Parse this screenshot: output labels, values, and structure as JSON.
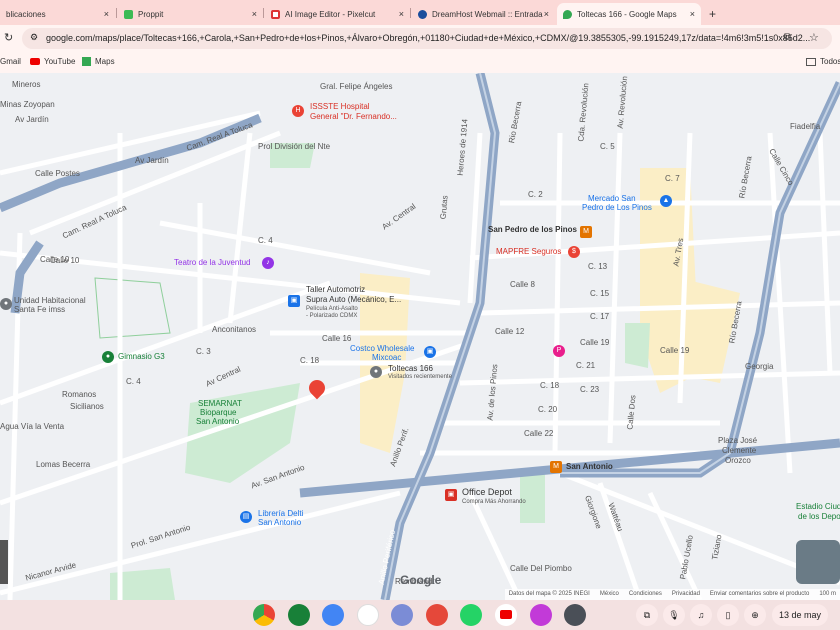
{
  "tabs": [
    {
      "title": "blicaciones"
    },
    {
      "title": "Proppit"
    },
    {
      "title": "AI Image Editor - Pixelcut"
    },
    {
      "title": "DreamHost Webmail :: Entrada"
    },
    {
      "title": "Toltecas 166 - Google Maps",
      "active": true
    }
  ],
  "tab_close": "×",
  "new_tab": "+",
  "url": "google.com/maps/place/Toltecas+166,+Carola,+San+Pedro+de+los+Pinos,+Álvaro+Obregón,+01180+Ciudad+de+México,+CDMX/@19.3855305,-99.1915249,17z/data=!4m6!3m5!1s0x85d2...",
  "bookmarks": [
    {
      "label": "Gmail"
    },
    {
      "label": "YouTube"
    },
    {
      "label": "Maps"
    }
  ],
  "all_bookmarks": "Todos",
  "map": {
    "labels": [
      "Gral. Felipe Ángeles",
      "Mineros",
      "Minas Zoyopan",
      "Av Jardín",
      "ISSSTE Hospital",
      "General \"Dr. Fernando...",
      "Prol División del Nte",
      "Av Jardín",
      "Calle Postes",
      "Cam. Real A Toluca",
      "Cam. Real A Toluca",
      "C. 5",
      "C. 7",
      "Mercado San",
      "Pedro de Los Pinos",
      "San Pedro de los Pinos",
      "MAPFRE Seguros",
      "C. 13",
      "Teatro de la Juventud",
      "Calle 10",
      "Taller Automotriz",
      "Supra Auto (Mecánico, E...",
      "Película Anti-Asalto",
      "- Polarizado CDMX",
      "Unidad Habitacional",
      "Santa Fe imss",
      "Gimnasio G3",
      "Costco Wholesale",
      "Mixcoac",
      "Toltecas 166",
      "Visitados recientemente",
      "SEMARNAT",
      "Bioparque",
      "San Antonio",
      "Calle 19",
      "C. 21",
      "C. 23",
      "C. 18",
      "C. 20",
      "Calle 22",
      "San Antonio",
      "Office Depot",
      "Compra Más Ahorrando",
      "Librería Delti",
      "San Antonio",
      "Plaza José",
      "Clemente",
      "Orozco",
      "Estadio Ciud",
      "de los Depo",
      "Anillo Periférico",
      "Anillo Perif.",
      "Río Becerra",
      "Río Becerra",
      "Av. San Antonio",
      "Prol. San Antonio",
      "Nicanor Arvide",
      "Romanos",
      "Sicilianos",
      "Lomas Becerra",
      "Agua Vía la Venta",
      "Av Central",
      "Calle 16",
      "C. 18",
      "Rembrandt",
      "Calle Del Piombo",
      "Wattéau",
      "Giorgione",
      "Av. Revolución",
      "Cda. Revolución",
      "Calle 12",
      "Calle 8",
      "C. 15",
      "C. 17",
      "Calle 19",
      "Av. Tres",
      "Fiadelfia",
      "C. 2",
      "C. 4",
      "Av. Central",
      "Heroes de 1914",
      "Grutas",
      "Rio Becerra",
      "Anconitanos",
      "C. 3",
      "C. 4",
      "Calle Cinco",
      "Av. de los Pinos",
      "Calle Dos",
      "Georgia",
      "Calle 10",
      "Tiziano",
      "Pablo Ucello"
    ],
    "google": "Google",
    "attribution": [
      "Datos del mapa © 2025 INEGI",
      "México",
      "Condiciones",
      "Privacidad",
      "Enviar comentarios sobre el producto",
      "100 m"
    ]
  },
  "shelf": {
    "date": "13 de may"
  }
}
